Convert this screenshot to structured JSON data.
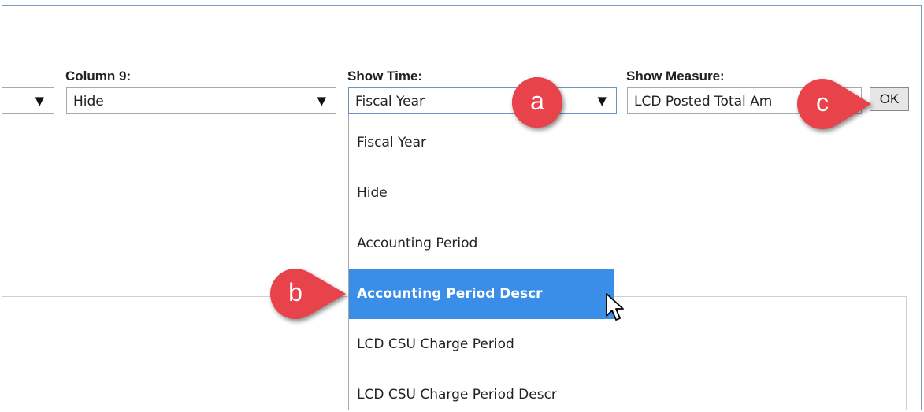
{
  "columns": [
    {
      "value": ""
    },
    {
      "label": "Column 9:",
      "value": "Hide"
    },
    {
      "label": "Show Time:",
      "value": "Fiscal Year"
    },
    {
      "label": "Show Measure:",
      "value": "LCD Posted Total Am"
    }
  ],
  "ok_label": "OK",
  "time_options": [
    {
      "label": "Fiscal Year"
    },
    {
      "label": "Hide"
    },
    {
      "label": "Accounting Period"
    },
    {
      "label": "Accounting Period Descr",
      "selected": true
    },
    {
      "label": "LCD CSU Charge Period"
    },
    {
      "label": "LCD CSU Charge Period Descr"
    }
  ],
  "callouts": [
    {
      "letter": "a"
    },
    {
      "letter": "b"
    },
    {
      "letter": "c"
    }
  ],
  "colors": {
    "callout": "#e8424a",
    "selected": "#3b8ee8",
    "frame_border": "#7a9cc6"
  },
  "icons": {
    "dropdown_arrow": "▼",
    "cursor": "arrow-pointer-icon"
  }
}
